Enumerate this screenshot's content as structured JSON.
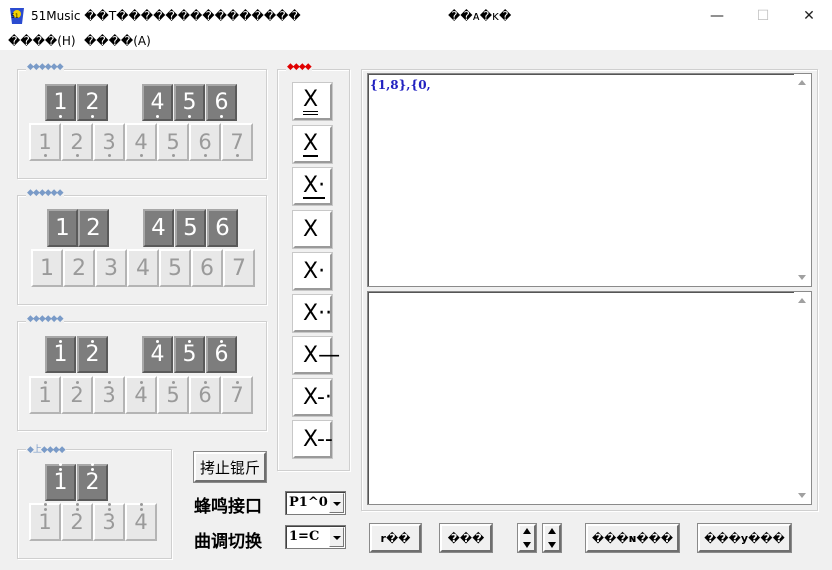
{
  "window": {
    "title": "51Music ��T���������������",
    "center_title": "��ᴀ�ᴋ�",
    "minimize": "—",
    "maximize": "☐",
    "close": "✕",
    "icon": "app-logo-icon"
  },
  "menu": [
    {
      "label": "����(H)"
    },
    {
      "label": "����(A)"
    }
  ],
  "groups": {
    "low": {
      "label": "◆◆◆◆◆◆",
      "black": [
        "1",
        "2",
        "4",
        "5",
        "6"
      ],
      "white": [
        "1",
        "2",
        "3",
        "4",
        "5",
        "6",
        "7"
      ]
    },
    "mid": {
      "label": "◆◆◆◆◆◆",
      "black": [
        "1",
        "2",
        "4",
        "5",
        "6"
      ],
      "white": [
        "1",
        "2",
        "3",
        "4",
        "5",
        "6",
        "7"
      ]
    },
    "high": {
      "label": "◆◆◆◆◆◆",
      "black": [
        "1",
        "2",
        "4",
        "5",
        "6"
      ],
      "white": [
        "1",
        "2",
        "3",
        "4",
        "5",
        "6",
        "7"
      ]
    },
    "top": {
      "label": "◆上◆◆◆◆",
      "black": [
        "1",
        "2"
      ],
      "white": [
        "1",
        "2",
        "3",
        "4"
      ]
    },
    "duration": {
      "label": "◆◆◆◆"
    }
  },
  "durations": [
    "X",
    "X",
    "X·",
    "X",
    "X·",
    "X··",
    "X—",
    "X-·",
    "X--"
  ],
  "editor": {
    "text": "{1,8},{0,",
    "output": ""
  },
  "controls": {
    "stop_button": "拷止锟斤",
    "buzzer_label": "蜂鸣接口",
    "buzzer_value": "P1^0",
    "key_label": "曲调切换",
    "key_value": "1=C"
  },
  "bottom_buttons": {
    "b1": "r��",
    "b2": "���",
    "b3": "���ɴ���",
    "b4": "���y���"
  },
  "colors": {
    "accent_red": "#e00000",
    "label_blue": "#7a9bc8",
    "text_blue": "#2020c0"
  }
}
